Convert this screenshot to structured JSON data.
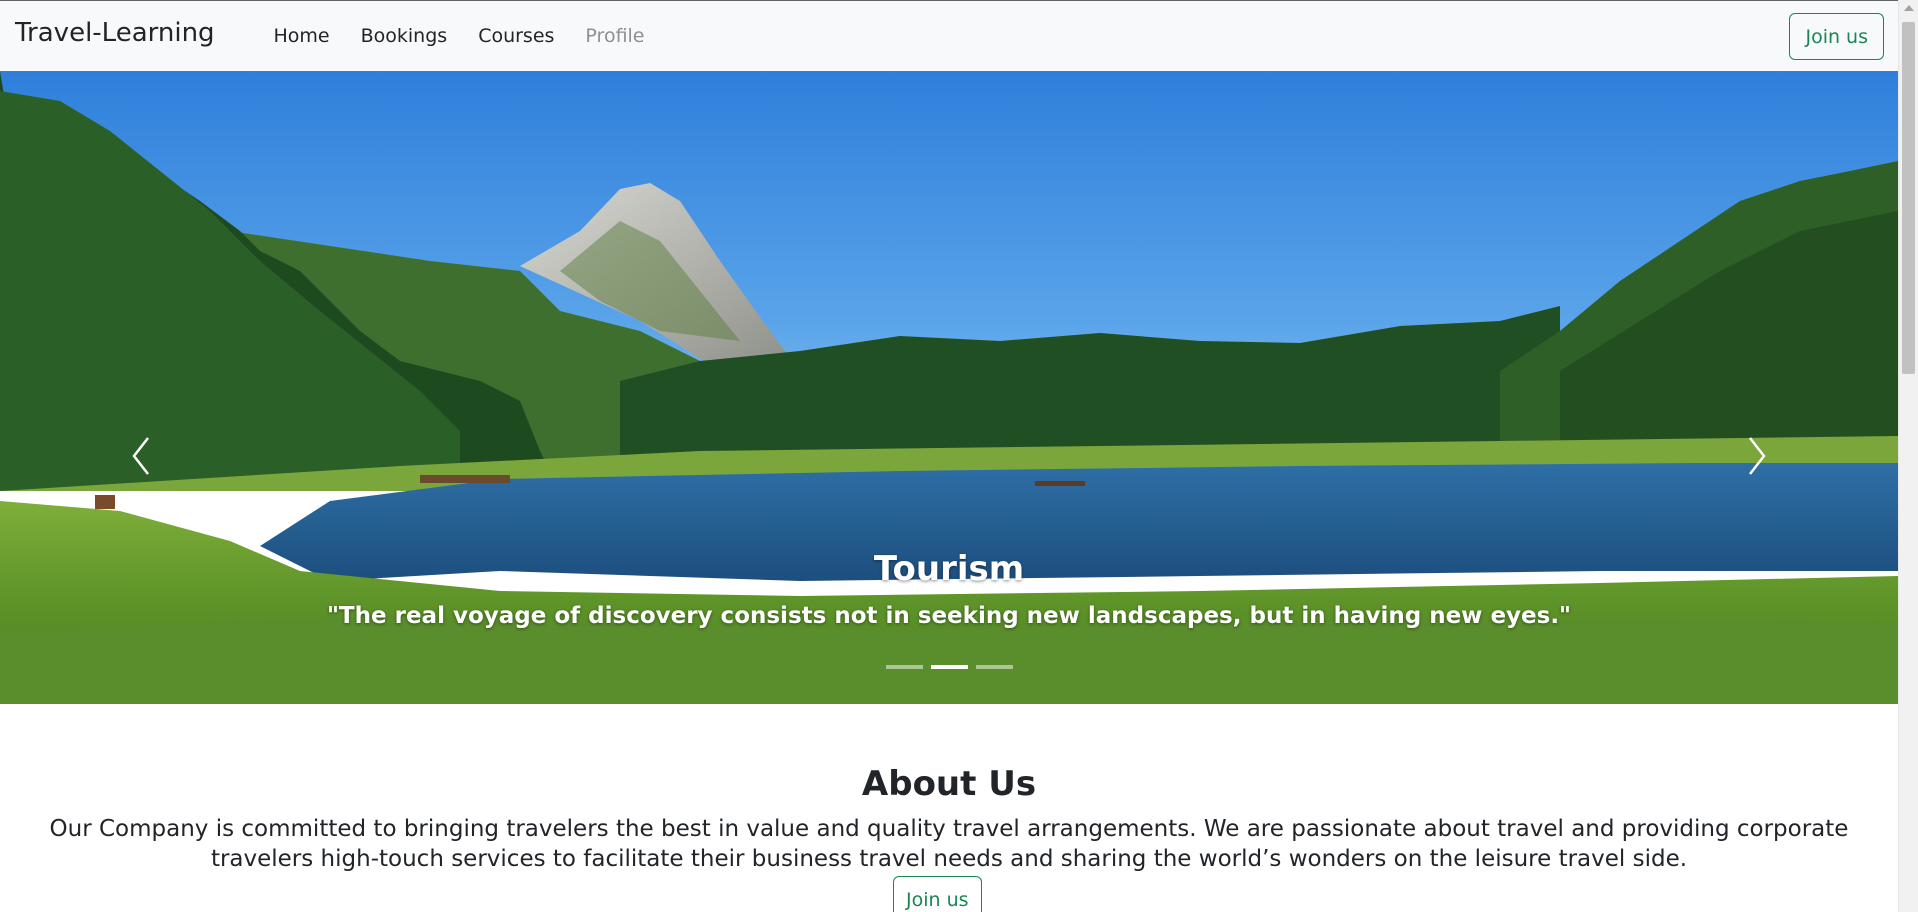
{
  "navbar": {
    "brand": "Travel-Learning",
    "links": [
      {
        "label": "Home",
        "disabled": false
      },
      {
        "label": "Bookings",
        "disabled": false
      },
      {
        "label": "Courses",
        "disabled": false
      },
      {
        "label": "Profile",
        "disabled": true
      }
    ],
    "join_label": "Join us"
  },
  "carousel": {
    "title": "Tourism",
    "quote": "\"The real voyage of discovery consists not in seeking new landscapes, but in having new eyes.\"",
    "slide_count": 3,
    "active_slide": 2
  },
  "about": {
    "title": "About Us",
    "text": "Our Company is committed to bringing travelers the best in value and quality travel arrangements. We are passionate about travel and providing corporate travelers high-touch services to facilitate their business travel needs and sharing the world’s wonders on the leisure travel side.",
    "join_label": "Join us"
  },
  "colors": {
    "accent": "#198754",
    "navbar_bg": "#f8f9fa",
    "text": "#212529",
    "muted": "#8d9094"
  }
}
